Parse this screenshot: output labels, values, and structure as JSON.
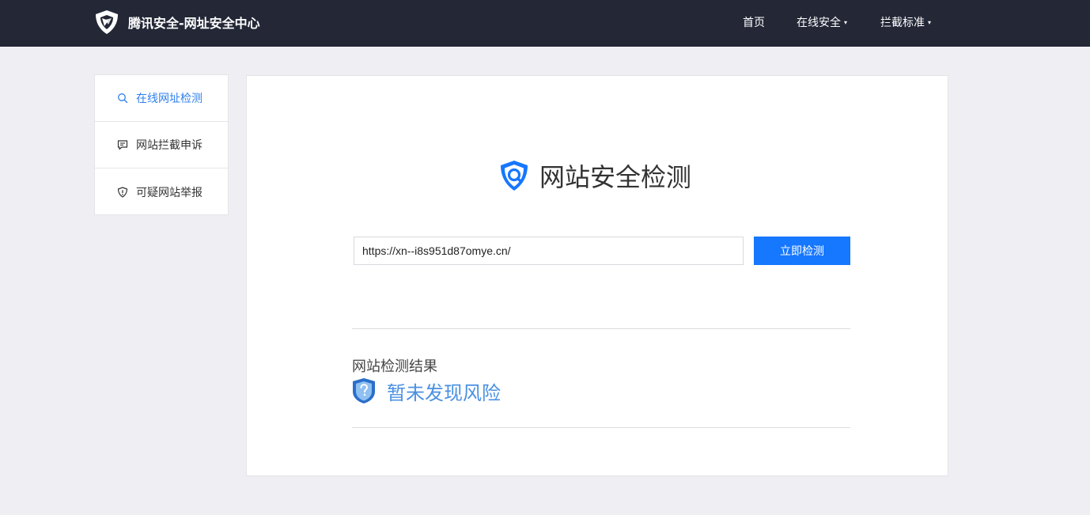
{
  "header": {
    "brand_icon": "tencent-shield-logo-icon",
    "brand_title": "腾讯安全-网址安全中心",
    "nav": [
      {
        "label": "首页",
        "has_dropdown": false
      },
      {
        "label": "在线安全",
        "has_dropdown": true
      },
      {
        "label": "拦截标准",
        "has_dropdown": true
      }
    ],
    "dropdown_glyph": "▾"
  },
  "sidebar": {
    "items": [
      {
        "label": "在线网址检测",
        "icon": "search-icon",
        "active": true
      },
      {
        "label": "网站拦截申诉",
        "icon": "message-icon",
        "active": false
      },
      {
        "label": "可疑网站举报",
        "icon": "shield-alert-icon",
        "active": false
      }
    ]
  },
  "main": {
    "hero_icon": "shield-search-icon",
    "hero_title": "网站安全检测",
    "url_value": "https://xn--i8s951d87omye.cn/",
    "check_button": "立即检测",
    "result_label": "网站检测结果",
    "result_icon": "shield-question-icon",
    "result_status": "暂未发现风险"
  },
  "colors": {
    "topbar_bg": "#232736",
    "page_bg": "#efeff3",
    "accent": "#1677ff",
    "active_link": "#2f80ed",
    "result_text": "#4a90e2"
  }
}
